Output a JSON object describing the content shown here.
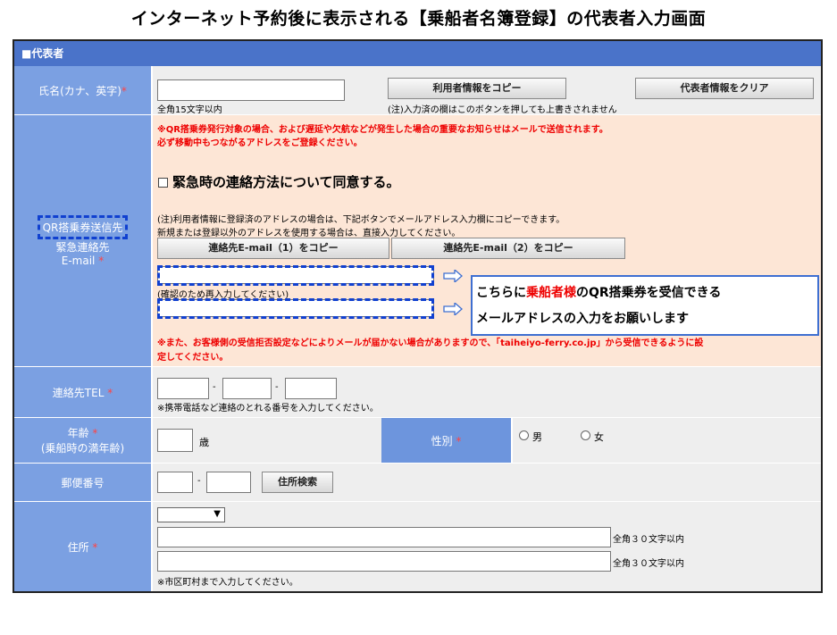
{
  "page_title": "インターネット予約後に表示される【乗船者名簿登録】の代表者入力画面",
  "header": "■代表者",
  "required_mark": "*",
  "name_row": {
    "label": "氏名(カナ、英字)",
    "hint": "全角15文字以内",
    "copy_button": "利用者情報をコピー",
    "clear_button": "代表者情報をクリア",
    "note": "(注)入力済の欄はこのボタンを押しても上書きされません"
  },
  "email_row": {
    "label_line1": "QR搭乗券送信先",
    "label_line2": "緊急連絡先",
    "label_line3": "E-mail",
    "warning1": "※QR搭乗券発行対象の場合、および遅延や欠航などが発生した場合の重要なお知らせはメールで送信されます。",
    "warning2": "必ず移動中もつながるアドレスをご登録ください。",
    "agree_label": "緊急時の連絡方法について同意する。",
    "note1": "(注)利用者情報に登録済のアドレスの場合は、下記ボタンでメールアドレス入力欄にコピーできます。",
    "note2": "新規または登録以外のアドレスを使用する場合は、直接入力してください。",
    "copy1_button": "連絡先E-mail（1）をコピー",
    "copy2_button": "連絡先E-mail（2）をコピー",
    "confirm_hint": "(確認のため再入力してください)",
    "callout_pre": "こちらに",
    "callout_highlight": "乗船者様",
    "callout_post": "のQR搭乗券を受信できる",
    "callout_line2": "メールアドレスの入力をお願いします",
    "footer_warning1": "※また、お客様側の受信拒否設定などによりメールが届かない場合がありますので、「taiheiyo-ferry.co.jp」から受信できるように設",
    "footer_warning2": "定してください。"
  },
  "tel_row": {
    "label": "連絡先TEL",
    "sep": "-",
    "hint": "※携帯電話など連絡のとれる番号を入力してください。"
  },
  "age_row": {
    "label_line1": "年齢",
    "label_line2": "(乗船時の満年齢)",
    "unit": "歳",
    "gender_label": "性別",
    "male": "男",
    "female": "女"
  },
  "zip_row": {
    "label": "郵便番号",
    "sep": "-",
    "search_button": "住所検索"
  },
  "address_row": {
    "label": "住所",
    "limit1": "全角３０文字以内",
    "limit2": "全角３０文字以内",
    "hint": "※市区町村まで入力してください。"
  },
  "colors": {
    "header": "#4a73c9",
    "label_bg": "#7ba0e2",
    "cell_bg": "#eeeeee",
    "notice_bg": "#fde6d6",
    "highlight_border": "#1040d0",
    "required": "#ff4444",
    "warning": "#e00000"
  }
}
